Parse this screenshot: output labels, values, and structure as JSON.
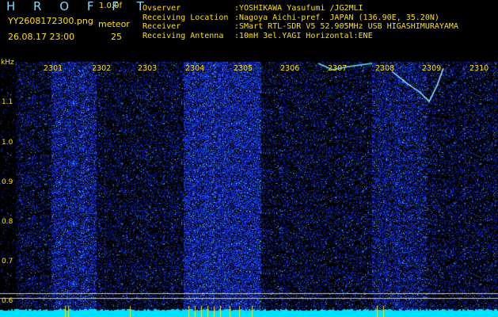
{
  "header": {
    "brand": "H R O F F T",
    "version": "1.0.0f",
    "filename": "YY2608172300.png",
    "datetime": "26.08.17 23:00",
    "meteor_label": "meteor",
    "meteor_count": "25",
    "info": [
      {
        "key": "Ovserver",
        "value": ":YOSHIKAWA Yasufumi /JG2MLI"
      },
      {
        "key": "Receiving Location",
        "value": ":Nagoya Aichi-pref. JAPAN (136.90E, 35.20N)"
      },
      {
        "key": "Receiver",
        "value": ":SMart RTL-SDR V5 52.905MHz USB HIGASHIMURAYAMA"
      },
      {
        "key": "Receiving Antenna",
        "value": ":10mH 3el.YAGI Horizontal:ENE"
      }
    ]
  },
  "axes": {
    "y_unit": "kHz",
    "y_ticks": [
      "1.1",
      "1.0",
      "0.9",
      "0.8",
      "0.7",
      "0.6"
    ],
    "x_ticks": [
      "2301",
      "2302",
      "2303",
      "2304",
      "2305",
      "2306",
      "2307",
      "2308",
      "2309",
      "2310"
    ]
  },
  "colors": {
    "text": "#ffe000",
    "brand": "#7fd8ff",
    "noise": "#1e2bd8",
    "baseline": "#00e0ff"
  }
}
